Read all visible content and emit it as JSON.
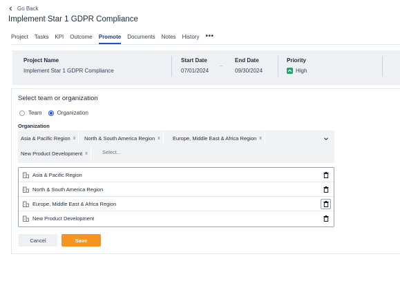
{
  "nav": {
    "back_label": "Go Back",
    "back_icon": "chevron-left-icon"
  },
  "page": {
    "title": "Implement Star 1 GDPR Compliance"
  },
  "tabs": [
    {
      "label": "Project",
      "active": false
    },
    {
      "label": "Tasks",
      "active": false
    },
    {
      "label": "KPI",
      "active": false
    },
    {
      "label": "Outcome",
      "active": false
    },
    {
      "label": "Promote",
      "active": true
    },
    {
      "label": "Documents",
      "active": false
    },
    {
      "label": "Notes",
      "active": false
    },
    {
      "label": "History",
      "active": false
    }
  ],
  "tabs_more": "•••",
  "summary": {
    "project_name_label": "Project Name",
    "project_name": "Implement Star 1 GDPR Compliance",
    "start_date_label": "Start Date",
    "start_date": "07/01/2024",
    "end_date_label": "End Date",
    "end_date": "09/30/2024",
    "priority_label": "Priority",
    "priority": "High",
    "arrow": "→",
    "priority_icon": "chevron-up-icon",
    "priority_color": "#22a06b"
  },
  "form": {
    "section_title": "Select team or organization",
    "radio_team": "Team",
    "radio_organization": "Organization",
    "selected_radio": "Organization",
    "org_label": "Organization",
    "chips": [
      "Asia & Pacific Region",
      "North & South America Region",
      "Europe, Middle East & Africa Region",
      "New Product Development"
    ],
    "chip_remove": "x",
    "placeholder": "Select..."
  },
  "selected_list": [
    {
      "label": "Asia & Pacific Region"
    },
    {
      "label": "North & South America Region"
    },
    {
      "label": "Europe, Middle East & Africa Region"
    },
    {
      "label": "New Product Development"
    }
  ],
  "actions": {
    "cancel": "Cancel",
    "save": "Save"
  },
  "colors": {
    "accent": "#1d4ed8",
    "save_button": "#f7941d",
    "panel_bg": "#eef0f3"
  }
}
